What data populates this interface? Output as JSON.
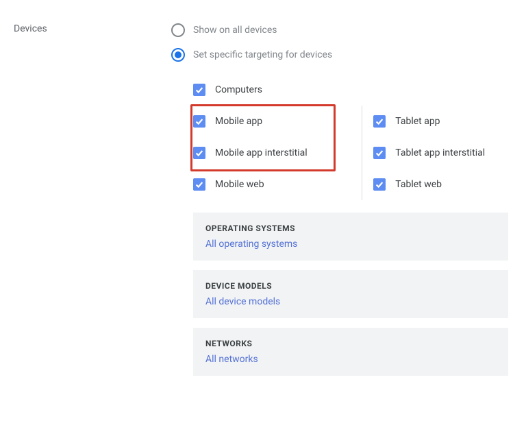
{
  "section": {
    "title": "Devices"
  },
  "radios": {
    "all": "Show on all devices",
    "specific": "Set specific targeting for devices"
  },
  "checkboxes": {
    "computers": "Computers",
    "mobile_app": "Mobile app",
    "mobile_app_interstitial": "Mobile app interstitial",
    "mobile_web": "Mobile web",
    "tablet_app": "Tablet app",
    "tablet_app_interstitial": "Tablet app interstitial",
    "tablet_web": "Tablet web"
  },
  "cards": {
    "os": {
      "title": "OPERATING SYSTEMS",
      "value": "All operating systems"
    },
    "models": {
      "title": "DEVICE MODELS",
      "value": "All device models"
    },
    "networks": {
      "title": "NETWORKS",
      "value": "All networks"
    }
  }
}
